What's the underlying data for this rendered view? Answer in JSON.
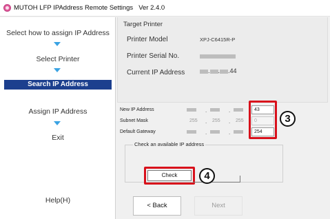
{
  "window": {
    "title": "MUTOH LFP IPAddress Remote Settings",
    "version": "Ver 2.4.0"
  },
  "sidebar": {
    "steps": [
      {
        "label": "Select how to assign IP Address"
      },
      {
        "label": "Select Printer"
      },
      {
        "label": "Search IP Address",
        "active": true
      },
      {
        "label": "Assign IP Address"
      },
      {
        "label": "Exit"
      }
    ],
    "help_label": "Help(H)",
    "arrow_color": "#3aa3e3",
    "active_color": "#1c3f8e"
  },
  "target_printer": {
    "title": "Target Printer",
    "model_label": "Printer Model",
    "model_value": "XPJ-C6415R-P",
    "serial_label": "Printer Serial No.",
    "current_ip_label": "Current IP Address",
    "current_ip_last_octet": ".44"
  },
  "network": {
    "new_ip": {
      "label": "New IP Address",
      "octet4": "43"
    },
    "subnet": {
      "label": "Subnet Mask",
      "octet1": "255",
      "octet2": "255",
      "octet3": "255",
      "octet4": "0"
    },
    "gateway": {
      "label": "Default Gateway",
      "octet4": "254"
    }
  },
  "check_group": {
    "label": "Check an available IP address",
    "button_label": "Check"
  },
  "callouts": {
    "step3": "3",
    "step4": "4"
  },
  "footer": {
    "back_label": "< Back",
    "next_label": "Next"
  },
  "colors": {
    "highlight_box": "#d8101b",
    "app_icon": "#e05a9a"
  }
}
